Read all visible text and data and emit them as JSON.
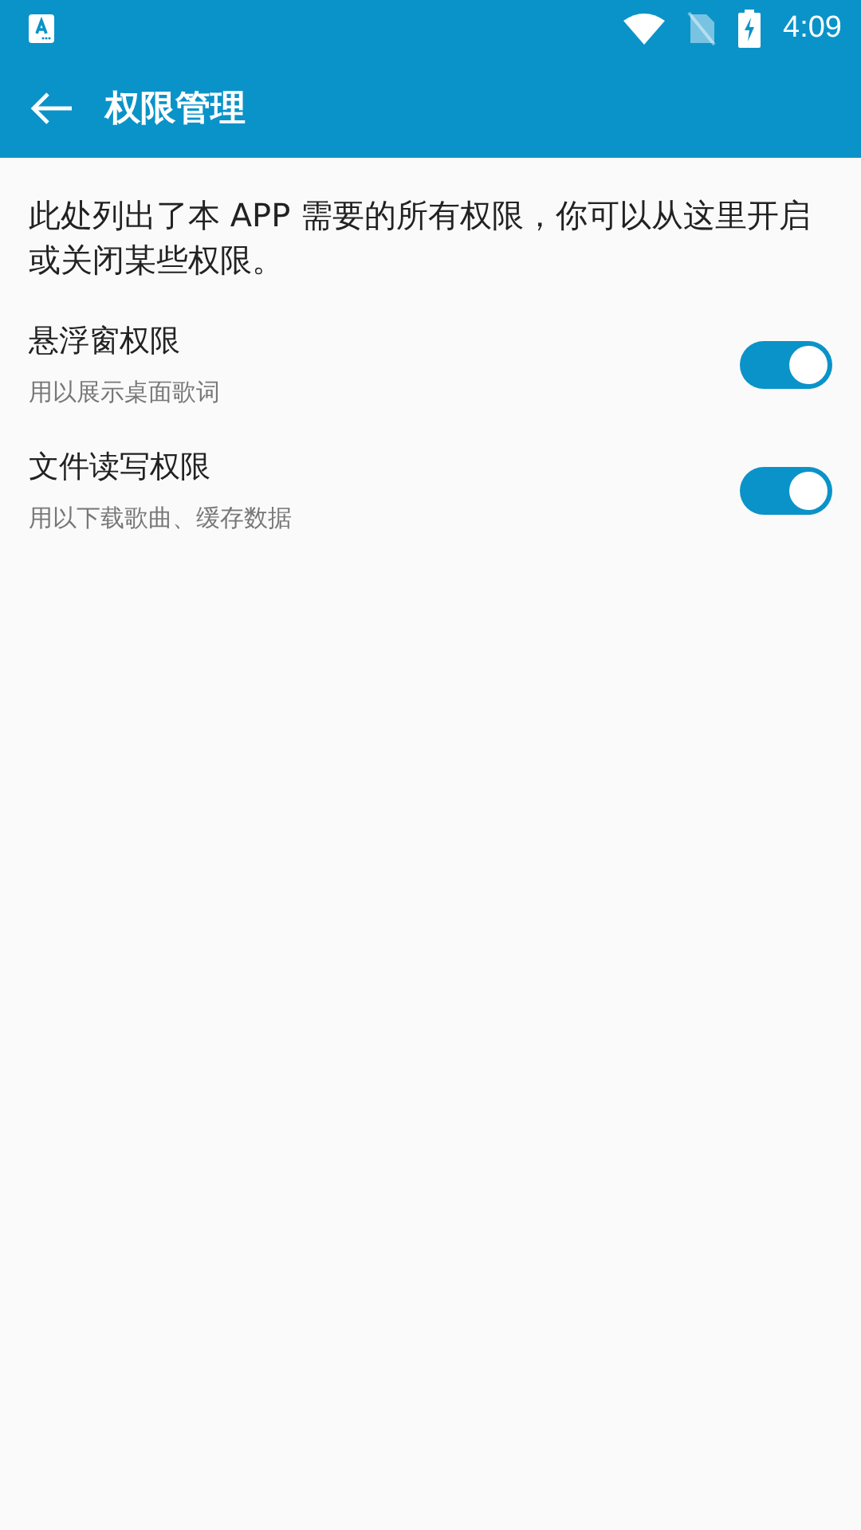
{
  "status_bar": {
    "time": "4:09"
  },
  "app_bar": {
    "title": "权限管理"
  },
  "intro": "此处列出了本 APP 需要的所有权限，你可以从这里开启或关闭某些权限。",
  "permissions": [
    {
      "title": "悬浮窗权限",
      "description": "用以展示桌面歌词",
      "on": true
    },
    {
      "title": "文件读写权限",
      "description": "用以下载歌曲、缓存数据",
      "on": true
    }
  ]
}
